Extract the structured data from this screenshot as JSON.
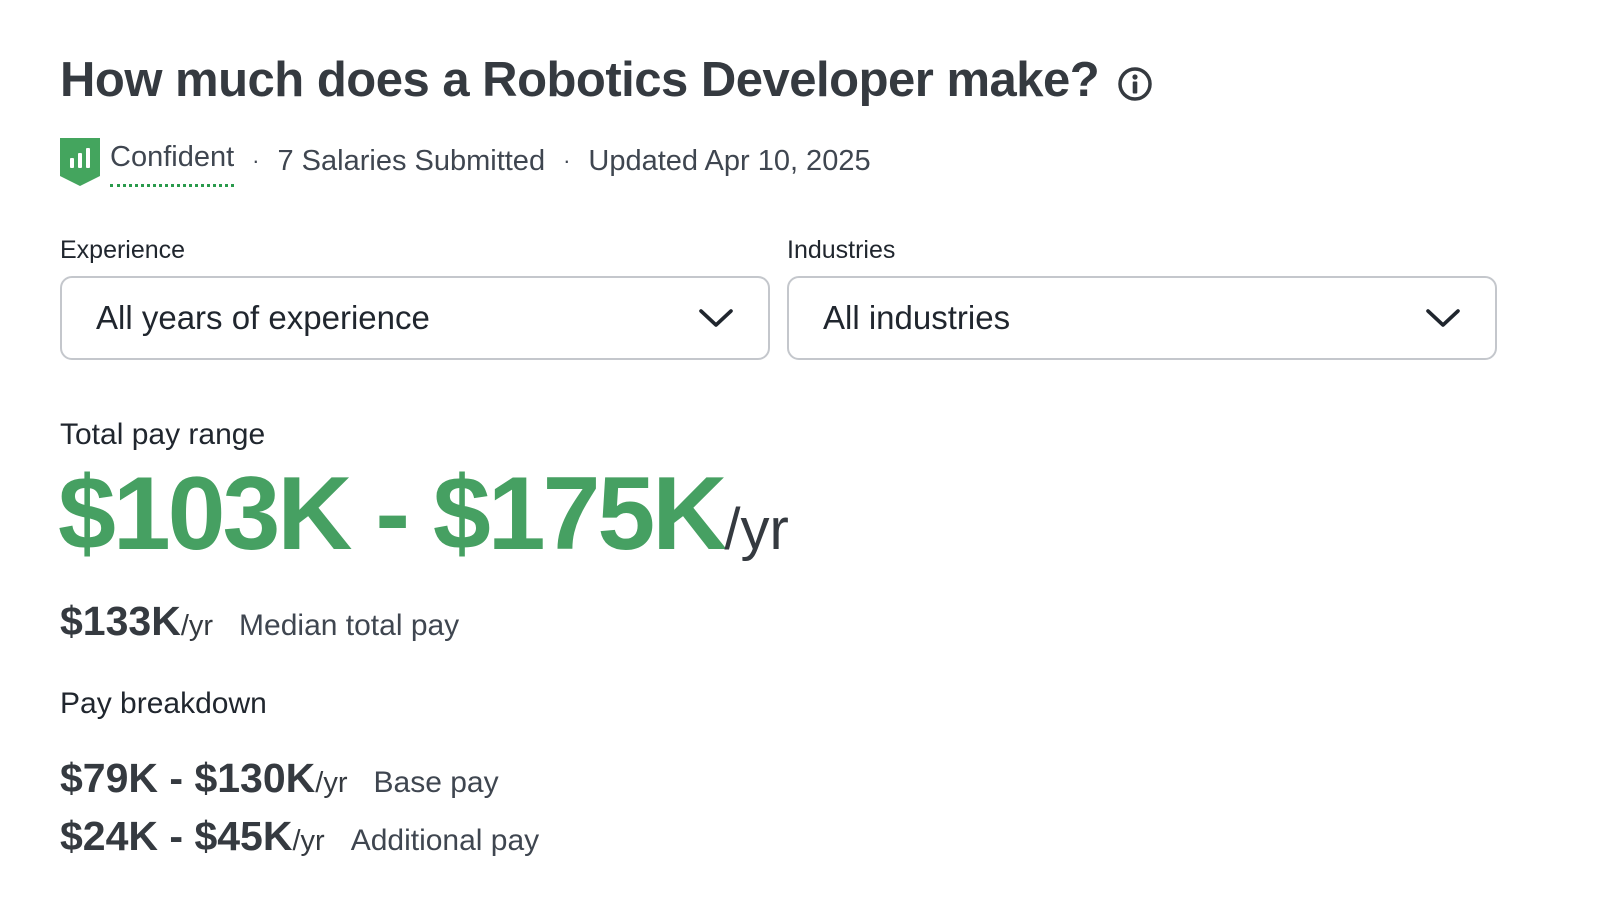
{
  "header": {
    "title": "How much does a Robotics Developer make?",
    "info_icon": "info-circle-icon"
  },
  "meta": {
    "confidence_icon": "bar-chart-shield-icon",
    "confidence_label": "Confident",
    "separator": "·",
    "salaries_submitted": "7 Salaries Submitted",
    "updated": "Updated Apr 10, 2025"
  },
  "filters": {
    "experience": {
      "label": "Experience",
      "selected": "All years of experience",
      "icon": "chevron-down-icon"
    },
    "industries": {
      "label": "Industries",
      "selected": "All industries",
      "icon": "chevron-down-icon"
    }
  },
  "total_pay": {
    "label": "Total pay range",
    "range": "$103K - $175K",
    "unit": "/yr",
    "median_amount": "$133K",
    "median_unit": "/yr",
    "median_caption": "Median total pay"
  },
  "breakdown": {
    "label": "Pay breakdown",
    "base": {
      "range": "$79K - $130K",
      "unit": "/yr",
      "caption": "Base pay"
    },
    "additional": {
      "range": "$24K - $45K",
      "unit": "/yr",
      "caption": "Additional pay"
    }
  },
  "colors": {
    "accent_green": "#46a062",
    "confidence_green": "#2a9a4c",
    "text_dark": "#353a40",
    "border": "#c4c7cc"
  }
}
